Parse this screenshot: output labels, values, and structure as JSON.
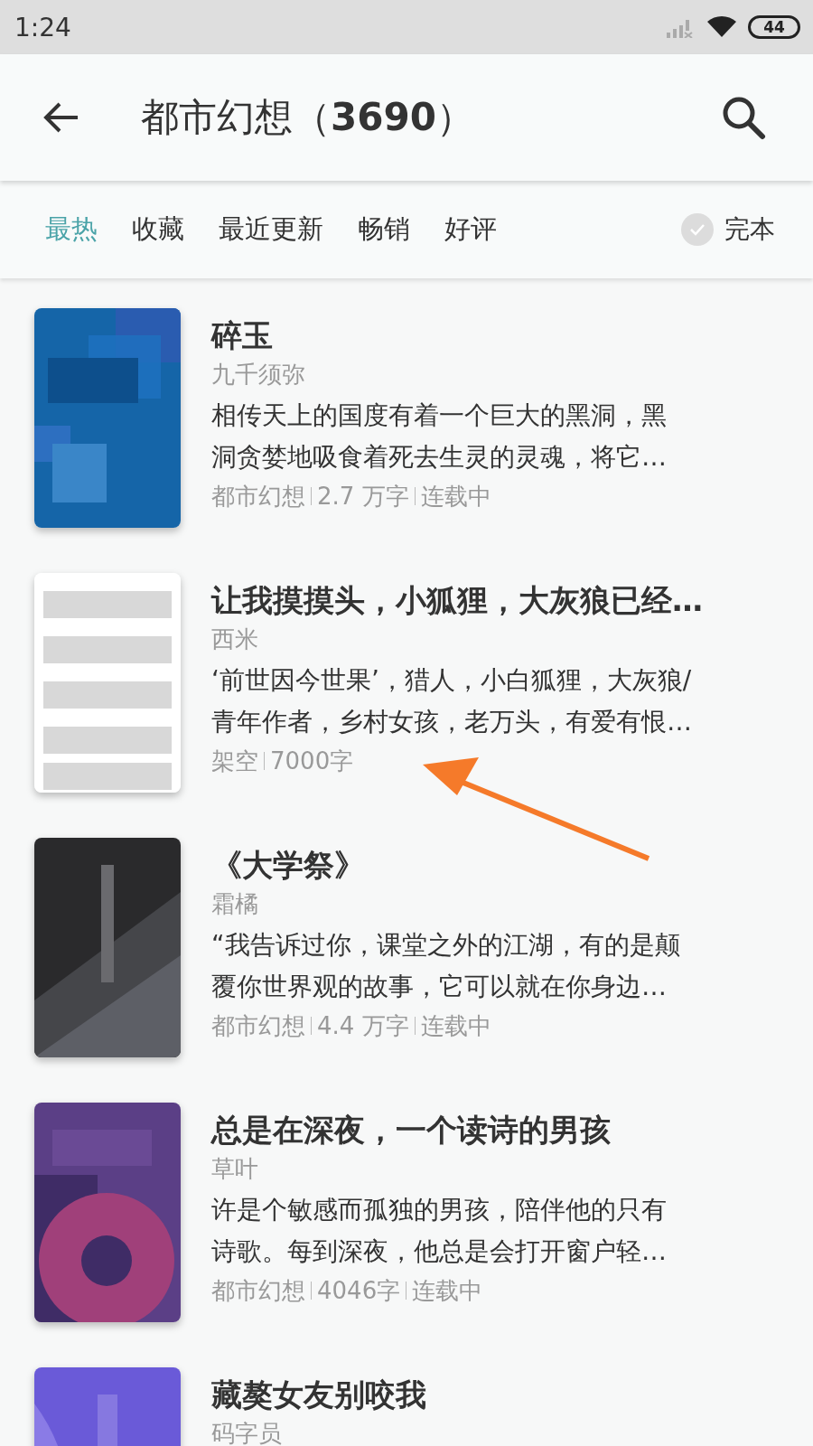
{
  "status_bar": {
    "time": "1:24",
    "battery": "44"
  },
  "header": {
    "title": "都市幻想（",
    "count": "3690",
    "title_end": "）"
  },
  "filters": [
    {
      "label": "最热",
      "selected": true
    },
    {
      "label": "收藏",
      "selected": false
    },
    {
      "label": "最近更新",
      "selected": false
    },
    {
      "label": "畅销",
      "selected": false
    },
    {
      "label": "好评",
      "selected": false
    }
  ],
  "complete_toggle": {
    "label": "完本",
    "checked": false
  },
  "books": [
    {
      "cover": {
        "kind": "picture"
      },
      "title": "碎玉",
      "author": "九千须弥",
      "description": [
        "相传天上的国度有着一个巨大的黑洞，黑",
        "洞贪婪地吸食着死去生灵的灵魂，将它…"
      ],
      "meta": [
        "都市幻想",
        "2.7 万字",
        "连载中"
      ]
    },
    {
      "cover": {
        "kind": "picture"
      },
      "title": "让我摸摸头，小狐狸，大灰狼已经…",
      "author": "西米",
      "description": [
        "‘前世因今世果’，猎人，小白狐狸，大灰狼/",
        "青年作者，乡村女孩，老万头，有爱有恨…"
      ],
      "meta": [
        "架空",
        "7000字"
      ]
    },
    {
      "cover": {
        "kind": "picture"
      },
      "title": "《大学祭》",
      "author": "霜橘",
      "description": [
        "“我告诉过你，课堂之外的江湖，有的是颠",
        "覆你世界观的故事，它可以就在你身边…"
      ],
      "meta": [
        "都市幻想",
        "4.4 万字",
        "连载中"
      ]
    },
    {
      "cover": {
        "kind": "picture"
      },
      "title": "总是在深夜，一个读诗的男孩",
      "author": "草叶",
      "description": [
        "许是个敏感而孤独的男孩，陪伴他的只有",
        "诗歌。每到深夜，他总是会打开窗户轻…"
      ],
      "meta": [
        "都市幻想",
        "4046字",
        "连载中"
      ]
    },
    {
      "cover": {
        "kind": "picture"
      },
      "title": "藏獒女友别咬我",
      "author": "码字员"
    }
  ]
}
